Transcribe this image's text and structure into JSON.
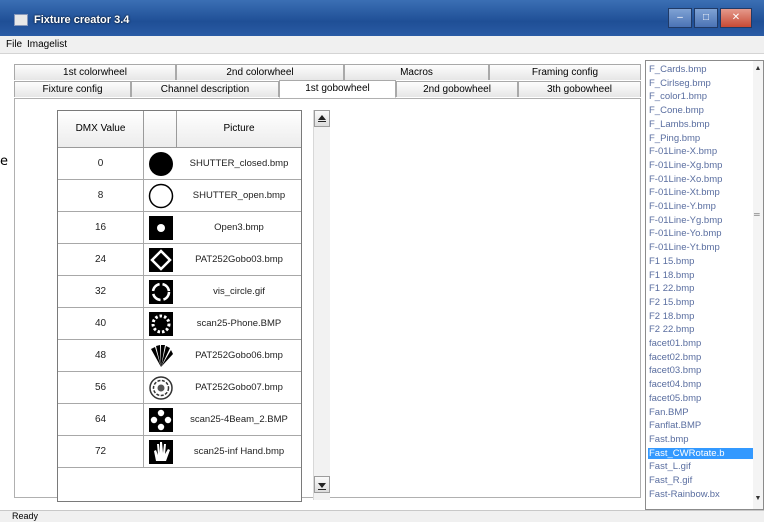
{
  "window": {
    "title": "Fixture creator 3.4",
    "buttons": [
      "–",
      "□",
      "✕"
    ]
  },
  "menu": [
    "File",
    "Imagelist"
  ],
  "tabs_row1": [
    "1st colorwheel",
    "2nd colorwheel",
    "Macros",
    "Framing config"
  ],
  "tabs_row2": [
    "Fixture config",
    "Channel description",
    "1st gobowheel",
    "2nd gobowheel",
    "3th gobowheel"
  ],
  "active_tab": "1st gobowheel",
  "edge_char": "e",
  "grid": {
    "headers": [
      "DMX Value",
      "",
      "Picture"
    ],
    "rows": [
      {
        "dmx": "0",
        "icon": "solid-circle-icon",
        "picture": "SHUTTER_closed.bmp"
      },
      {
        "dmx": "8",
        "icon": "open-circle-icon",
        "picture": "SHUTTER_open.bmp"
      },
      {
        "dmx": "16",
        "icon": "open3-icon",
        "picture": "Open3.bmp"
      },
      {
        "dmx": "24",
        "icon": "diamond-gobo-icon",
        "picture": "PAT252Gobo03.bmp"
      },
      {
        "dmx": "32",
        "icon": "ring-gobo-icon",
        "picture": "vis_circle.gif"
      },
      {
        "dmx": "40",
        "icon": "dotted-ring-gobo-icon",
        "picture": "scan25-Phone.BMP"
      },
      {
        "dmx": "48",
        "icon": "fan-gobo-icon",
        "picture": "PAT252Gobo06.bmp"
      },
      {
        "dmx": "56",
        "icon": "flower-gobo-icon",
        "picture": "PAT252Gobo07.bmp"
      },
      {
        "dmx": "64",
        "icon": "four-beam-gobo-icon",
        "picture": "scan25-4Beam_2.BMP"
      },
      {
        "dmx": "72",
        "icon": "hand-gobo-icon",
        "picture": "scan25-inf Hand.bmp"
      }
    ]
  },
  "filelist": {
    "items": [
      "F_Cards.bmp",
      "F_Cirlseg.bmp",
      "F_color1.bmp",
      "F_Cone.bmp",
      "F_Lambs.bmp",
      "F_Ping.bmp",
      "F-01Line-X.bmp",
      "F-01Line-Xg.bmp",
      "F-01Line-Xo.bmp",
      "F-01Line-Xt.bmp",
      "F-01Line-Y.bmp",
      "F-01Line-Yg.bmp",
      "F-01Line-Yo.bmp",
      "F-01Line-Yt.bmp",
      "F1 15.bmp",
      "F1 18.bmp",
      "F1 22.bmp",
      "F2 15.bmp",
      "F2 18.bmp",
      "F2 22.bmp",
      "facet01.bmp",
      "facet02.bmp",
      "facet03.bmp",
      "facet04.bmp",
      "facet05.bmp",
      "Fan.BMP",
      "Fanflat.BMP",
      "Fast.bmp",
      "Fast_CWRotate.b",
      "Fast_L.gif",
      "Fast_R.gif",
      "Fast-Rainbow.bx"
    ],
    "selected_index": 28
  },
  "status": "Ready",
  "colors": {
    "title_bar": "#2a5ba5",
    "selection": "#3399ff",
    "filelist_text": "#5a6ea0"
  }
}
